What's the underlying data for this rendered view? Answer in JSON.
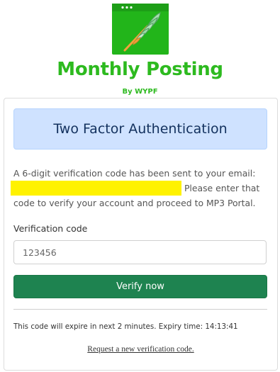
{
  "brand": {
    "title": "Monthly Posting",
    "subtitle": "By WYPF",
    "logo_icon": "browser-window-feather-icon",
    "colors": {
      "brand_green": "#2dba1f",
      "icon_bg": "#22b51a",
      "feather": "#8fd49a"
    }
  },
  "card": {
    "header_title": "Two Factor Authentication",
    "header_bg": "#cfe2ff",
    "header_text_color": "#13315e",
    "message_before": "A 6-digit verification code has been sent to your email:",
    "message_after": "Please enter that code to verify your account and proceed to MP3 Portal.",
    "redaction_color": "#fff200",
    "code_label": "Verification code",
    "code_placeholder": "123456",
    "verify_button": "Verify now",
    "button_color": "#1e8350",
    "expiry_text": "This code will expire in next 2 minutes. Expiry time: 14:13:41",
    "request_link": "Request a new verification code."
  }
}
